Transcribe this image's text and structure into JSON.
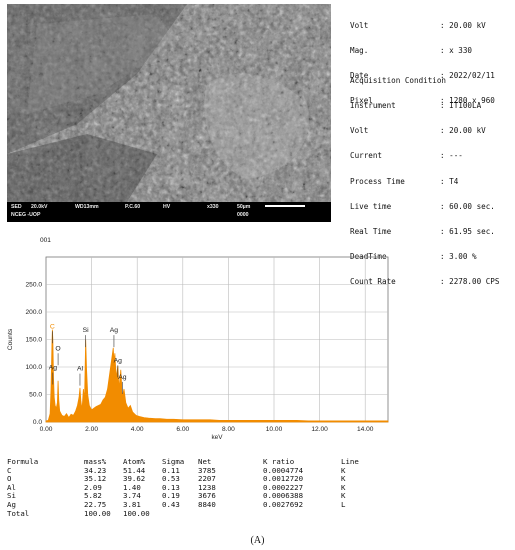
{
  "sem": {
    "footer_line1": [
      "SED",
      "20.0kV",
      "WD13mm",
      "P.C.60",
      "HV",
      "x330",
      "50µm"
    ],
    "footer_line2": [
      "NCEG -UOP",
      "0000"
    ]
  },
  "info": {
    "top": [
      {
        "k": "Volt",
        "v": ": 20.00 kV"
      },
      {
        "k": "Mag.",
        "v": ": x 330"
      },
      {
        "k": "Date",
        "v": ": 2022/02/11"
      },
      {
        "k": "Pixel",
        "v": ": 1280 x 960"
      }
    ],
    "acq_title": "Acquisition Condition",
    "acq": [
      {
        "k": "Instrument",
        "v": ": IT100LA"
      },
      {
        "k": "Volt",
        "v": ": 20.00 kV"
      },
      {
        "k": "Current",
        "v": ": ---"
      },
      {
        "k": "Process Time",
        "v": ": T4"
      },
      {
        "k": "Live time",
        "v": ": 60.00 sec."
      },
      {
        "k": "Real Time",
        "v": ": 61.95 sec."
      },
      {
        "k": "DeadTime",
        "v": ": 3.00 %"
      },
      {
        "k": "Count Rate",
        "v": ": 2278.00 CPS"
      }
    ]
  },
  "chart_data": {
    "type": "line",
    "title": "001",
    "xlabel": "keV",
    "ylabel": "Counts",
    "xlim": [
      0,
      15
    ],
    "ylim": [
      0,
      300
    ],
    "x_ticks": [
      "0.00",
      "2.00",
      "4.00",
      "6.00",
      "8.00",
      "10.00",
      "12.00",
      "14.00"
    ],
    "y_ticks": [
      "0.0",
      "50.0",
      "100.0",
      "150.0",
      "200.0",
      "250.0"
    ],
    "color": "#f28c00",
    "peak_labels": [
      {
        "label": "C",
        "x": 0.28,
        "y": 165
      },
      {
        "label": "O",
        "x": 0.53,
        "y": 125
      },
      {
        "label": "Ag",
        "x": 0.3,
        "y": 90
      },
      {
        "label": "Al",
        "x": 1.49,
        "y": 88
      },
      {
        "label": "Si",
        "x": 1.74,
        "y": 158
      },
      {
        "label": "Ag",
        "x": 2.98,
        "y": 158
      },
      {
        "label": "Ag",
        "x": 3.15,
        "y": 103
      },
      {
        "label": "Ag",
        "x": 3.35,
        "y": 73
      }
    ],
    "series": [
      {
        "x": [
          0.0,
          0.1,
          0.18,
          0.22,
          0.26,
          0.28,
          0.3,
          0.33,
          0.36,
          0.4,
          0.45,
          0.5,
          0.53,
          0.56,
          0.6,
          0.7,
          0.8,
          0.9,
          1.0,
          1.1,
          1.2,
          1.3,
          1.38,
          1.45,
          1.49,
          1.53,
          1.58,
          1.64,
          1.69,
          1.74,
          1.78,
          1.83,
          1.9,
          2.0,
          2.1,
          2.2,
          2.3,
          2.4,
          2.5,
          2.6,
          2.7,
          2.8,
          2.9,
          2.95,
          2.98,
          3.02,
          3.08,
          3.15,
          3.2,
          3.28,
          3.35,
          3.42,
          3.5,
          3.6,
          3.7,
          3.8,
          3.95,
          4.1,
          4.3,
          4.5,
          4.8,
          5.0,
          5.3,
          5.6,
          6.0,
          6.4,
          6.8,
          7.2,
          7.6,
          8.0,
          8.5,
          9.0,
          9.5,
          10.0,
          10.5,
          11.0,
          11.5,
          12.0,
          12.5,
          13.0,
          13.5,
          14.0,
          14.5,
          15.0
        ],
        "y": [
          2,
          3,
          15,
          60,
          140,
          168,
          150,
          80,
          45,
          30,
          25,
          35,
          75,
          40,
          20,
          12,
          10,
          15,
          8,
          14,
          12,
          20,
          30,
          45,
          62,
          38,
          22,
          60,
          40,
          150,
          95,
          50,
          30,
          22,
          25,
          28,
          30,
          32,
          40,
          45,
          60,
          90,
          120,
          135,
          110,
          125,
          80,
          102,
          60,
          95,
          45,
          60,
          35,
          25,
          30,
          18,
          12,
          10,
          8,
          7,
          6,
          6,
          5,
          5,
          4,
          4,
          4,
          4,
          3,
          3,
          3,
          3,
          3,
          3,
          3,
          3,
          2,
          2,
          2,
          2,
          2,
          2,
          2,
          2
        ]
      }
    ]
  },
  "table": {
    "header": [
      "Formula",
      "mass%",
      "Atom%",
      "Sigma",
      "Net",
      "K ratio",
      "Line"
    ],
    "rows": [
      [
        "C",
        "34.23",
        "51.44",
        "0.11",
        "3785",
        "0.0004774",
        "K"
      ],
      [
        "O",
        "35.12",
        "39.62",
        "0.53",
        "2207",
        "0.0012720",
        "K"
      ],
      [
        "Al",
        "2.09",
        "1.40",
        "0.13",
        "1238",
        "0.0002227",
        "K"
      ],
      [
        "Si",
        "5.82",
        "3.74",
        "0.19",
        "3676",
        "0.0006388",
        "K"
      ],
      [
        "Ag",
        "22.75",
        "3.81",
        "0.43",
        "8840",
        "0.0027692",
        "L"
      ],
      [
        "Total",
        "100.00",
        "100.00",
        "",
        "",
        "",
        ""
      ]
    ]
  },
  "caption": "(A)"
}
